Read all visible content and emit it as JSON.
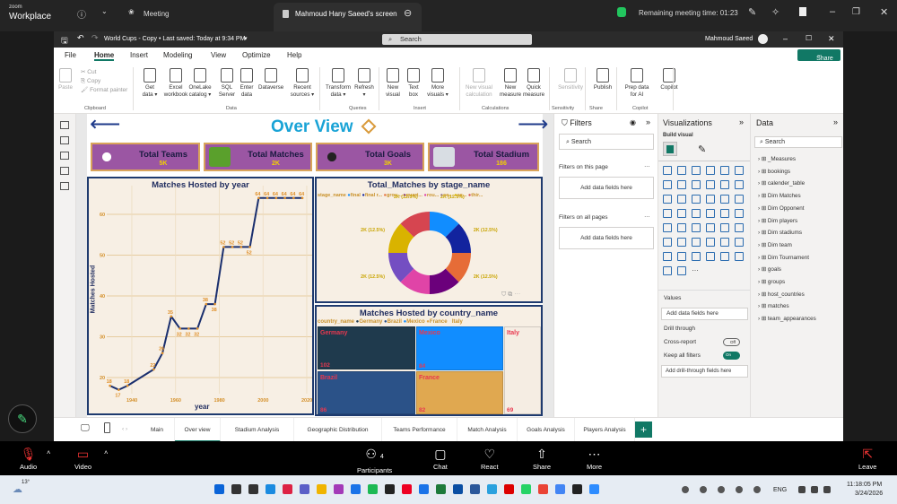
{
  "zoom_top": {
    "brand_small": "zoom",
    "brand": "Workplace",
    "meeting_label": "Meeting",
    "share_tab": "Mahmoud Hany Saeed's screen",
    "remaining": "Remaining meeting time: 01:23"
  },
  "pbi": {
    "file_title": "World Cups - Copy • Last saved: Today at 9:34 PM",
    "search": "Search",
    "user": "Mahmoud Saeed",
    "menu": [
      "File",
      "Home",
      "Insert",
      "Modeling",
      "View",
      "Optimize",
      "Help"
    ],
    "active_menu": "Home",
    "share": "Share",
    "ribbon": [
      {
        "label": "Paste",
        "disabled": true
      },
      {
        "label": "Get data",
        "dd": true
      },
      {
        "label": "Excel workbook"
      },
      {
        "label": "OneLake catalog",
        "dd": true
      },
      {
        "label": "SQL Server"
      },
      {
        "label": "Enter data"
      },
      {
        "label": "Dataverse"
      },
      {
        "label": "Recent sources",
        "dd": true
      },
      {
        "label": "Transform data",
        "dd": true
      },
      {
        "label": "Refresh",
        "dd": true
      },
      {
        "label": "New visual"
      },
      {
        "label": "Text box"
      },
      {
        "label": "More visuals",
        "dd": true
      },
      {
        "label": "New visual calculation",
        "disabled": true
      },
      {
        "label": "New measure"
      },
      {
        "label": "Quick measure"
      },
      {
        "label": "Sensitivity",
        "disabled": true
      },
      {
        "label": "Publish"
      },
      {
        "label": "Prep data for AI"
      },
      {
        "label": "Copilot"
      }
    ],
    "clipboard_items": [
      "Cut",
      "Copy",
      "Format painter"
    ],
    "groups": [
      "Clipboard",
      "Data",
      "Queries",
      "Insert",
      "Calculations",
      "Sensitivity",
      "Share",
      "Copilot"
    ]
  },
  "report": {
    "title": "Over View",
    "kpis": [
      {
        "label": "Total Teams",
        "value": "5K",
        "icon": "team-icon"
      },
      {
        "label": "Total Matches",
        "value": "2K",
        "icon": "pitch-icon"
      },
      {
        "label": "Total Goals",
        "value": "3K",
        "icon": "goal-net-icon"
      },
      {
        "label": "Total Stadium",
        "value": "186",
        "icon": "stadium-icon"
      }
    ]
  },
  "chart_data": [
    {
      "type": "line",
      "title": "Matches Hosted by year",
      "xlabel": "year",
      "ylabel": "Matches Hosted",
      "xlim": [
        1928,
        2022
      ],
      "ylim": [
        15,
        68
      ],
      "xticks": [
        1940,
        1960,
        1980,
        2000,
        2020
      ],
      "yticks": [
        20,
        30,
        40,
        50,
        60
      ],
      "grid": true,
      "line_color": "#1a2f6e",
      "label_color": "#e0902a",
      "x": [
        1930,
        1934,
        1938,
        1950,
        1954,
        1958,
        1962,
        1966,
        1970,
        1974,
        1978,
        1982,
        1986,
        1990,
        1994,
        1998,
        2002,
        2006,
        2010,
        2014,
        2018
      ],
      "y": [
        18,
        17,
        18,
        22,
        26,
        35,
        32,
        32,
        32,
        38,
        38,
        52,
        52,
        52,
        52,
        64,
        64,
        64,
        64,
        64,
        64
      ]
    },
    {
      "type": "pie",
      "title": "Total_Matches by stage_name",
      "legend_title": "stage_name",
      "legend": "top",
      "categories": [
        "final",
        "final r...",
        "grou...",
        "quart...",
        "rou...",
        "se...",
        "se...",
        "thir..."
      ],
      "values": [
        12.5,
        12.5,
        12.5,
        12.5,
        12.5,
        12.5,
        12.5,
        12.5
      ],
      "labels": [
        "2K (12.5%)",
        "2K (12.5%)",
        "2K (12.5%)",
        "2K (12.5%)",
        "2K (12.5%)",
        "2K (12.5%)",
        "2K (12.5%)",
        "2K (12.5%)"
      ],
      "colors": [
        "#118dff",
        "#12239e",
        "#e66c37",
        "#6b007b",
        "#e044a7",
        "#744ec2",
        "#d9b300",
        "#d64550"
      ]
    },
    {
      "type": "treemap",
      "title": "Matches Hosted by country_name",
      "legend_title": "country_name",
      "legend": "top",
      "categories": [
        "Germany",
        "Brazil",
        "Mexico",
        "France",
        "Italy"
      ],
      "values": [
        102,
        86,
        84,
        82,
        69
      ],
      "colors": [
        "#1f3a4d",
        "#2b5288",
        "#118dff",
        "#e0a850",
        "#f5ede3"
      ]
    }
  ],
  "filters": {
    "title": "Filters",
    "search": "Search",
    "on_page": "Filters on this page",
    "on_all": "Filters on all pages",
    "add": "Add data fields here"
  },
  "viz": {
    "title": "Visualizations",
    "build": "Build visual",
    "values": "Values",
    "add": "Add data fields here",
    "drill": "Drill through",
    "cross": "Cross-report",
    "cross_state": "Off",
    "keep": "Keep all filters",
    "keep_state": "On",
    "add_drill": "Add drill-through fields here"
  },
  "data_pane": {
    "title": "Data",
    "search": "Search",
    "tables": [
      "_Measures",
      "bookings",
      "calender_table",
      "Dim Matches",
      "Dim Opponent",
      "Dim players",
      "Dim stadiums",
      "Dim team",
      "Dim Tournament",
      "goals",
      "groups",
      "host_countries",
      "matches",
      "team_appearances"
    ]
  },
  "page_tabs": [
    "Main",
    "Over view",
    "Stadium Analysis",
    "Geographic Distribution",
    "Teams Performance",
    "Match Analysis",
    "Goals Analysis",
    "Players Analysis"
  ],
  "active_tab": "Over view",
  "zoom_bottom": {
    "audio": "Audio",
    "video": "Video",
    "participants": "Participants",
    "participants_count": "4",
    "chat": "Chat",
    "react": "React",
    "share": "Share",
    "more": "More",
    "leave": "Leave"
  },
  "taskbar": {
    "weather": "13°",
    "lang": "ENG",
    "time": "11:18:05 PM",
    "date": "3/24/2026"
  }
}
